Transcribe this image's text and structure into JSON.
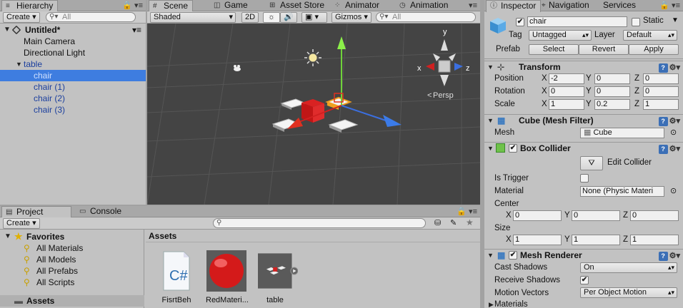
{
  "hierarchy": {
    "tab": "Hierarchy",
    "create_label": "Create",
    "search_placeholder": "All",
    "scene_name": "Untitled*",
    "items": [
      {
        "label": "Main Camera"
      },
      {
        "label": "Directional Light"
      },
      {
        "label": "table"
      },
      {
        "label": "chair"
      },
      {
        "label": "chair (1)"
      },
      {
        "label": "chair (2)"
      },
      {
        "label": "chair (3)"
      }
    ]
  },
  "scene": {
    "tabs": [
      "Scene",
      "Game",
      "Asset Store",
      "Animator",
      "Animation"
    ],
    "shading": "Shaded",
    "mode_2d": "2D",
    "gizmos": "Gizmos",
    "search_placeholder": "All",
    "persp_label": "Persp",
    "axis_y": "y",
    "axis_x": "x",
    "axis_z": "z"
  },
  "project": {
    "tabs": [
      "Project",
      "Console"
    ],
    "create_label": "Create",
    "favorites_label": "Favorites",
    "favorites": [
      "All Materials",
      "All Models",
      "All Prefabs",
      "All Scripts"
    ],
    "assets_root": "Assets",
    "assets_header": "Assets",
    "assets": [
      {
        "label": "FisrtBeh",
        "icon": "csharp-script-icon"
      },
      {
        "label": "RedMateri...",
        "icon": "red-material-icon"
      },
      {
        "label": "table",
        "icon": "table-prefab-icon"
      }
    ]
  },
  "inspector": {
    "tabs": [
      "Inspector",
      "Navigation",
      "Services"
    ],
    "object_name": "chair",
    "static_label": "Static",
    "tag_label": "Tag",
    "tag_value": "Untagged",
    "layer_label": "Layer",
    "layer_value": "Default",
    "prefab_label": "Prefab",
    "prefab_select": "Select",
    "prefab_revert": "Revert",
    "prefab_apply": "Apply",
    "transform": {
      "title": "Transform",
      "rows": [
        {
          "label": "Position",
          "x": "-2",
          "y": "0",
          "z": "0"
        },
        {
          "label": "Rotation",
          "x": "0",
          "y": "0",
          "z": "0"
        },
        {
          "label": "Scale",
          "x": "1",
          "y": "0.2",
          "z": "1"
        }
      ]
    },
    "mesh_filter": {
      "title": "Cube (Mesh Filter)",
      "mesh_label": "Mesh",
      "mesh_value": "Cube"
    },
    "box_collider": {
      "title": "Box Collider",
      "edit_label": "Edit Collider",
      "is_trigger_label": "Is Trigger",
      "material_label": "Material",
      "material_value": "None (Physic Materi",
      "center_label": "Center",
      "center": {
        "x": "0",
        "y": "0",
        "z": "0"
      },
      "size_label": "Size",
      "size": {
        "x": "1",
        "y": "1",
        "z": "1"
      }
    },
    "mesh_renderer": {
      "title": "Mesh Renderer",
      "cast_shadows_label": "Cast Shadows",
      "cast_shadows_value": "On",
      "receive_shadows_label": "Receive Shadows",
      "motion_vectors_label": "Motion Vectors",
      "motion_vectors_value": "Per Object Motion",
      "materials_label": "Materials"
    }
  }
}
